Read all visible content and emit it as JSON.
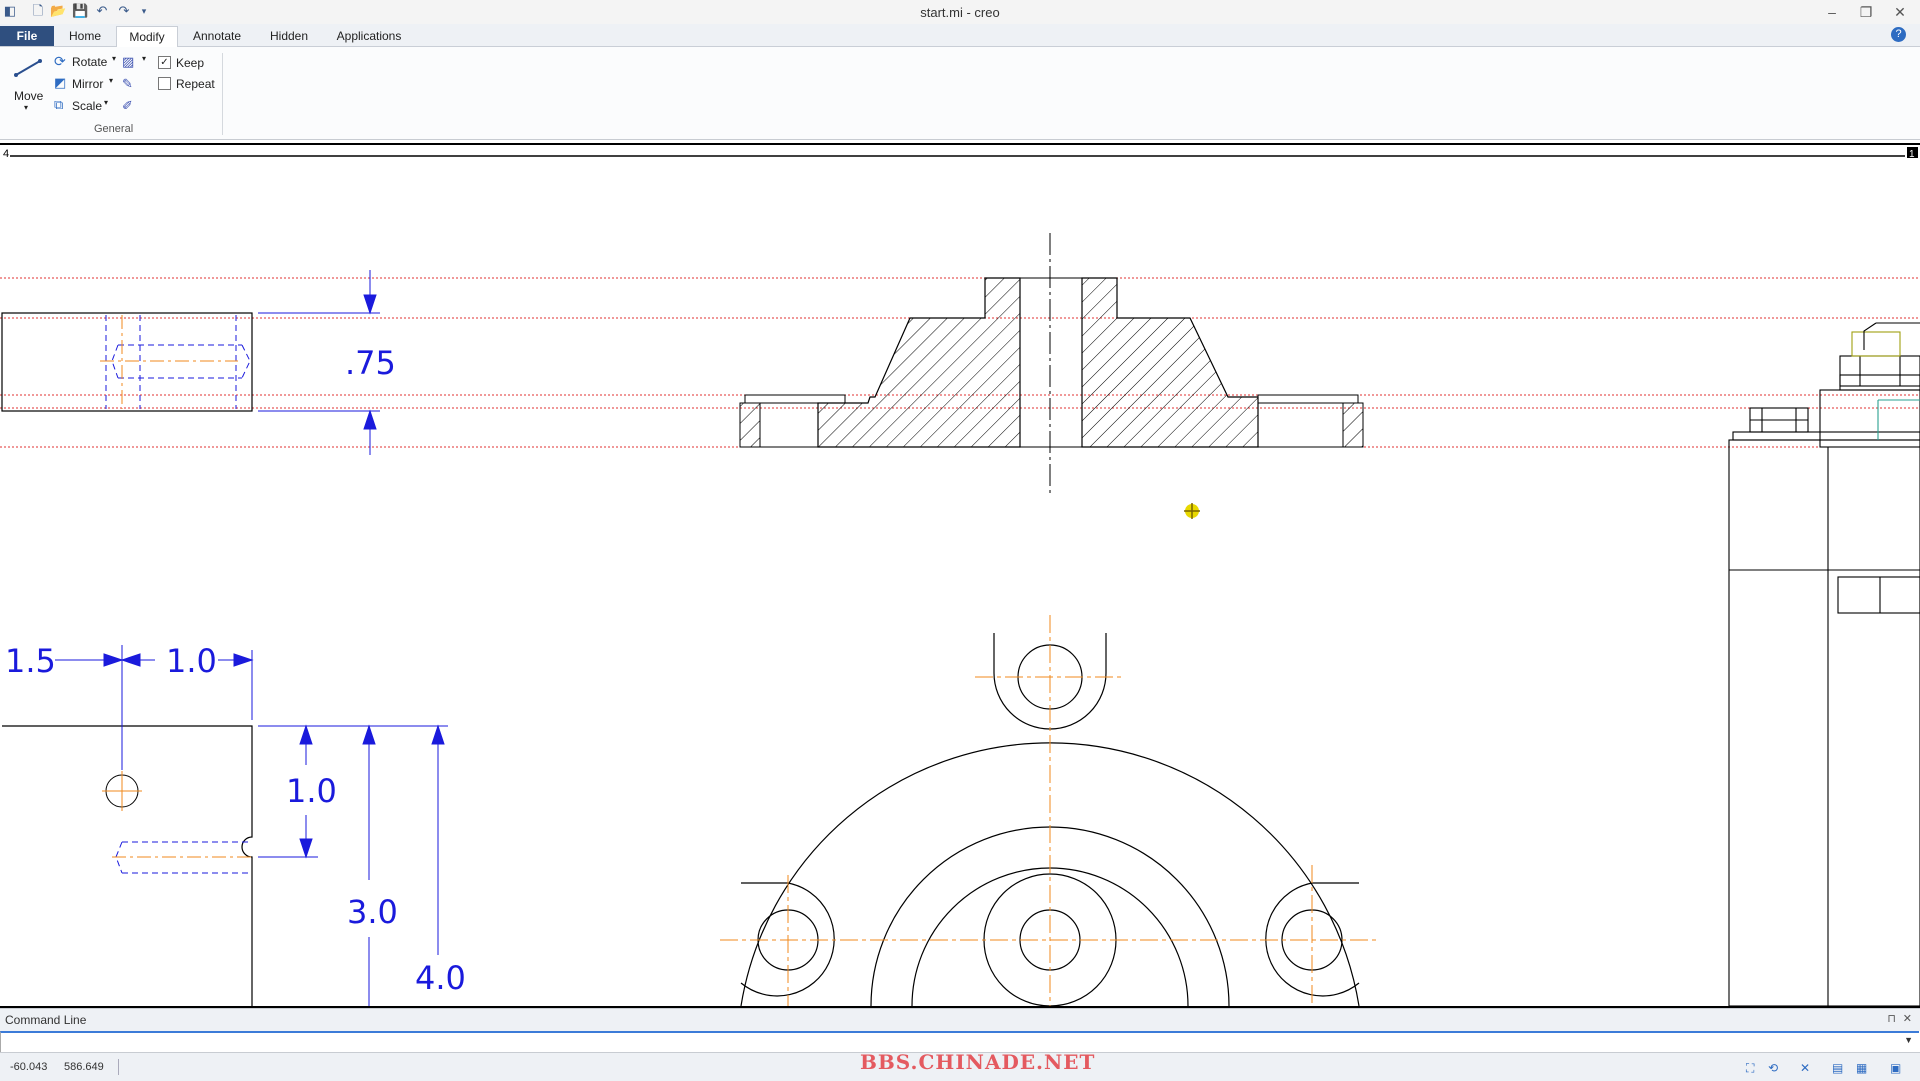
{
  "window": {
    "title": "start.mi - creo",
    "quick_access_icons": [
      "new-file-icon",
      "open-folder-icon",
      "save-icon",
      "undo-icon",
      "redo-icon",
      "customize-dropdown-icon"
    ],
    "controls": [
      "minimize-icon",
      "restore-icon",
      "close-icon"
    ]
  },
  "tabs": {
    "file": "File",
    "items": [
      "Home",
      "Modify",
      "Annotate",
      "Hidden",
      "Applications"
    ],
    "active": "Modify"
  },
  "ribbon": {
    "move_label": "Move",
    "rotate_label": "Rotate",
    "mirror_label": "Mirror",
    "scale_label": "Scale",
    "keep_label": "Keep",
    "keep_checked": "✓",
    "repeat_label": "Repeat",
    "group_label": "General"
  },
  "canvas": {
    "sheet_left_label": "4",
    "sheet_right_label": "1",
    "dimensions": {
      "d075": ".75",
      "d15": "1.5",
      "d10a": "1.0",
      "d10b": "1.0",
      "d30": "3.0",
      "d40": "4.0"
    },
    "colors": {
      "dimension": "#1a1adc",
      "centerline": "#f08a1c",
      "construction": "#e23030",
      "geometry": "#000000",
      "cursor": "#e8d800"
    }
  },
  "command_line": {
    "label": "Command Line",
    "value": ""
  },
  "status": {
    "x": "-60.043",
    "y": "586.649",
    "watermark": "BBS.CHINADE.NET"
  }
}
